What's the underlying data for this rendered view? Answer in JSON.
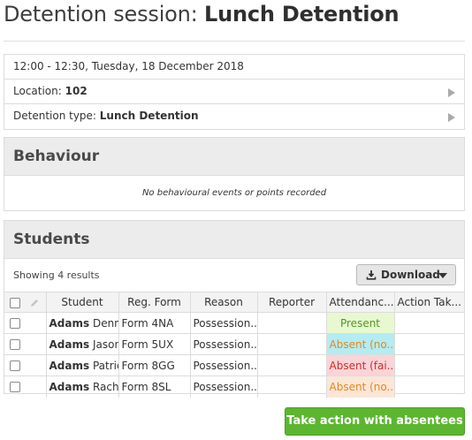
{
  "header": {
    "title_prefix": "Detention session: ",
    "title_name": "Lunch Detention"
  },
  "info": {
    "datetime": "12:00 - 12:30, Tuesday, 18 December 2018",
    "location_label": "Location: ",
    "location_value": "102",
    "type_label": "Detention type: ",
    "type_value": "Lunch Detention"
  },
  "behaviour": {
    "heading": "Behaviour",
    "empty_text": "No behavioural events or points recorded"
  },
  "students": {
    "heading": "Students",
    "showing": "Showing 4 results",
    "download_label": "Download",
    "columns": {
      "student": "Student",
      "reg_form": "Reg. Form",
      "reason": "Reason",
      "reporter": "Reporter",
      "attendance": "Attendanc...",
      "action": "Action Tak..."
    },
    "rows": [
      {
        "surname": "Adams",
        "forename": "Denni",
        "reg_form": "Form 4NA",
        "reason": "Possession...",
        "reporter": "",
        "attendance": "Present",
        "attendance_status": "present",
        "action": ""
      },
      {
        "surname": "Adams",
        "forename": "Jason",
        "reg_form": "Form 5UX",
        "reason": "Possession...",
        "reporter": "",
        "attendance": "Absent (no...",
        "attendance_status": "absent-notice",
        "action": ""
      },
      {
        "surname": "Adams",
        "forename": "Patric",
        "reg_form": "Form 8GG",
        "reason": "Possession...",
        "reporter": "",
        "attendance": "Absent (fai...",
        "attendance_status": "absent-fail",
        "action": ""
      },
      {
        "surname": "Adams",
        "forename": "Rache",
        "reg_form": "Form 8SL",
        "reason": "Possession...",
        "reporter": "",
        "attendance": "Absent (no...",
        "attendance_status": "absent-other",
        "action": ""
      }
    ]
  },
  "actions": {
    "take_action_label": "Take action with absentees"
  },
  "colors": {
    "primary_button": "#5cb630",
    "present_bg": "#e8f8d0",
    "absent_notice_bg": "#b3ecf3",
    "absent_fail_bg": "#fbd4d8",
    "absent_other_bg": "#fde6d8"
  },
  "icons": {
    "info_arrow": "chevron-right-icon",
    "download": "download-icon",
    "dropdown": "caret-down-icon",
    "edit": "pencil-icon"
  }
}
